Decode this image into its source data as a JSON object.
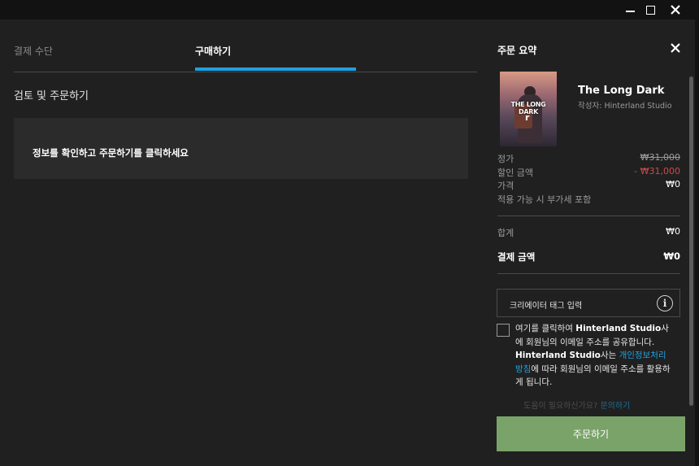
{
  "window": {
    "minimize_icon": "minimize-icon",
    "maximize_icon": "maximize-icon",
    "close_icon": "close-icon"
  },
  "checkout": {
    "tabs": [
      {
        "label": "결제 수단",
        "active": false
      },
      {
        "label": "구매하기",
        "active": true
      }
    ],
    "section_title": "검토 및 주문하기",
    "instruction": "정보를 확인하고 주문하기를 클릭하세요"
  },
  "summary": {
    "title": "주문 요약",
    "game": {
      "cover_text": "THE LONG DARK",
      "title": "The Long Dark",
      "studio": "작성자: Hinterland Studio"
    },
    "price_rows": [
      {
        "label": "정가",
        "value": "₩31,000"
      },
      {
        "label": "할인 금액",
        "value": "- ₩31,000"
      },
      {
        "label": "가격",
        "value": "₩0"
      }
    ],
    "tax_note": "적용 가능 시 부가세 포함",
    "subtotal": {
      "label": "합계",
      "value": "₩0"
    },
    "total": {
      "label": "결제 금액",
      "value": "₩0"
    },
    "creator_tag_placeholder": "크리에이터 태그 입력",
    "consent": {
      "part1": "여기를 클릭하여 ",
      "studio1": "Hinterland Studio",
      "part2": "사에 회원님의 이메일 주소를 공유합니다. ",
      "studio2": "Hinterland Studio",
      "part3": "사는 ",
      "link": "개인정보처리방침",
      "part4": "에 따라 회원님의 이메일 주소를 활용하게 됩니다."
    },
    "help_text": "도움이 필요하신가요? ",
    "help_link": "문의하기",
    "order_button": "주문하기"
  },
  "colors": {
    "accent": "#1fa1e1",
    "order_button": "#7aa36a",
    "discount": "#d04848"
  }
}
